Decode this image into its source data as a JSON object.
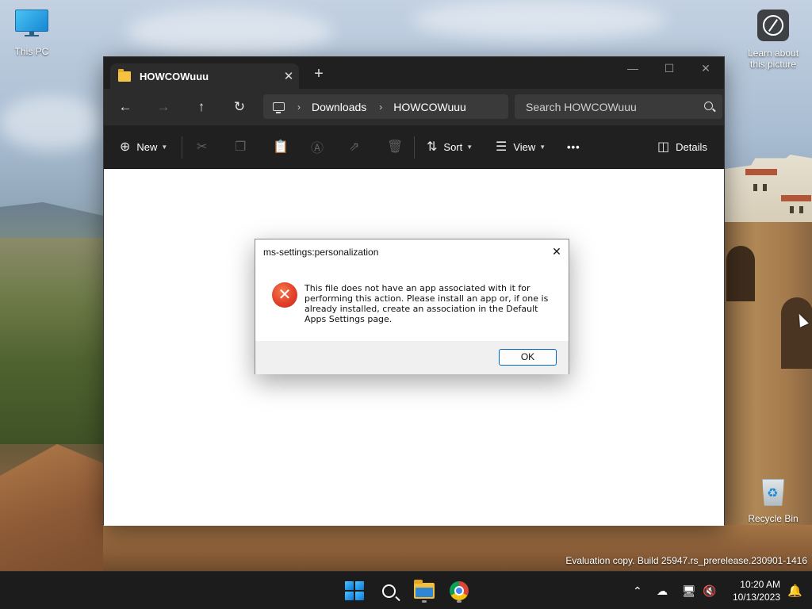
{
  "desktop": {
    "icons": [
      {
        "label": "This PC",
        "icon": "monitor-icon"
      },
      {
        "label": "Learn about this picture",
        "icon": "learn-about-picture-icon"
      },
      {
        "label": "Recycle Bin",
        "icon": "recycle-bin-icon"
      }
    ],
    "evaluation_text": "Evaluation copy. Build 25947.rs_prerelease.230901-1416"
  },
  "explorer": {
    "tab_title": "HOWCOWuuu",
    "tab_close_glyph": "✕",
    "new_tab_glyph": "+",
    "window_controls": {
      "minimize": "—",
      "maximize": "☐",
      "close": "✕"
    },
    "nav": {
      "back": "←",
      "forward": "→",
      "up": "↑",
      "refresh": "↻"
    },
    "breadcrumb": [
      "Downloads",
      "HOWCOWuuu"
    ],
    "breadcrumb_separator": "›",
    "search_placeholder": "Search HOWCOWuuu",
    "commands": {
      "new_label": "New",
      "sort_label": "Sort",
      "view_label": "View",
      "more_glyph": "•••",
      "details_label": "Details"
    }
  },
  "dialog": {
    "title": "ms-settings:personalization",
    "close_glyph": "✕",
    "error_glyph": "✕",
    "message": "This file does not have an app associated with it for performing this action. Please install an app or, if one is already installed, create an association in the Default Apps Settings page.",
    "ok_label": "OK"
  },
  "taskbar": {
    "apps": [
      "start-icon",
      "search-icon",
      "file-explorer-icon",
      "chrome-icon"
    ],
    "tray": {
      "chevron": "⌃"
    },
    "clock": {
      "time": "10:20 AM",
      "date": "10/13/2023"
    },
    "notification_glyph": "🔔"
  },
  "colors": {
    "accent": "#0067c0",
    "error": "#e2402a",
    "explorer_dark": "#202020",
    "taskbar": "#1c1c1c"
  }
}
